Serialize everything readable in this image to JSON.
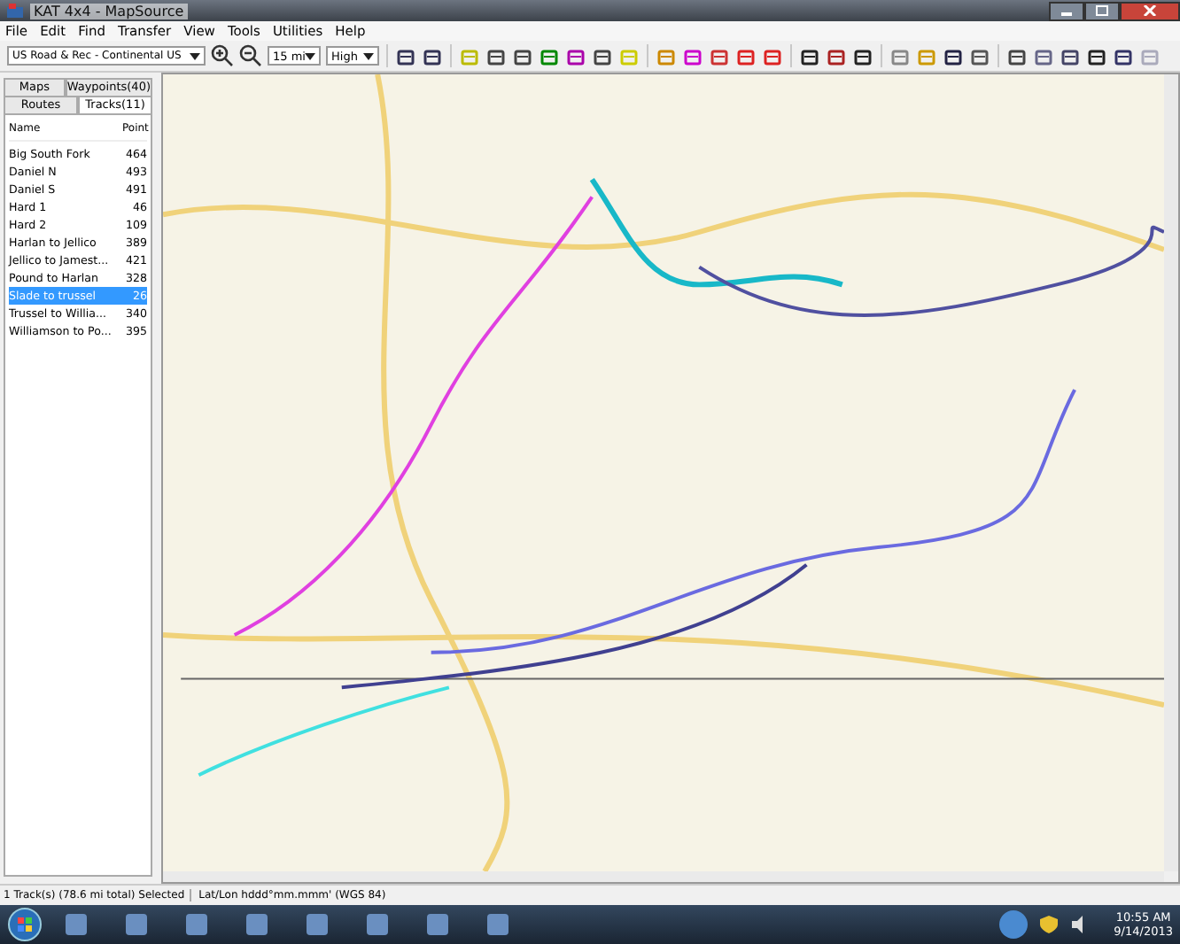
{
  "window": {
    "title": "KAT 4x4 - MapSource"
  },
  "menu": [
    "File",
    "Edit",
    "Find",
    "Transfer",
    "View",
    "Tools",
    "Utilities",
    "Help"
  ],
  "toolbar": {
    "map_product": "US Road & Rec - Continental US",
    "zoom_scale": "15 mi",
    "detail": "High"
  },
  "tab_rows": [
    [
      {
        "label": "Maps",
        "selected": false
      },
      {
        "label": "Waypoints(40)",
        "selected": false
      }
    ],
    [
      {
        "label": "Routes",
        "selected": false
      },
      {
        "label": "Tracks(11)",
        "selected": true
      }
    ]
  ],
  "tracks": {
    "columns": [
      "Name",
      "Point"
    ],
    "rows": [
      {
        "name": "Big South Fork",
        "points": "464",
        "selected": false
      },
      {
        "name": "Daniel N",
        "points": "493",
        "selected": false
      },
      {
        "name": "Daniel S",
        "points": "491",
        "selected": false
      },
      {
        "name": "Hard 1",
        "points": "46",
        "selected": false
      },
      {
        "name": "Hard 2",
        "points": "109",
        "selected": false
      },
      {
        "name": "Harlan to Jellico",
        "points": "389",
        "selected": false
      },
      {
        "name": "Jellico to Jamest...",
        "points": "421",
        "selected": false
      },
      {
        "name": "Pound to Harlan",
        "points": "328",
        "selected": false
      },
      {
        "name": "Slade to trussel",
        "points": "26",
        "selected": true
      },
      {
        "name": "Trussel to Willia...",
        "points": "340",
        "selected": false
      },
      {
        "name": "Williamson to Po...",
        "points": "395",
        "selected": false
      }
    ]
  },
  "status_bar": [
    "1 Track(s) (78.6 mi total) Selected",
    "Lat/Lon hddd°mm.mmm' (WGS 84)"
  ],
  "taskbar": {
    "time": "10:55 AM",
    "date": "9/14/2013"
  }
}
